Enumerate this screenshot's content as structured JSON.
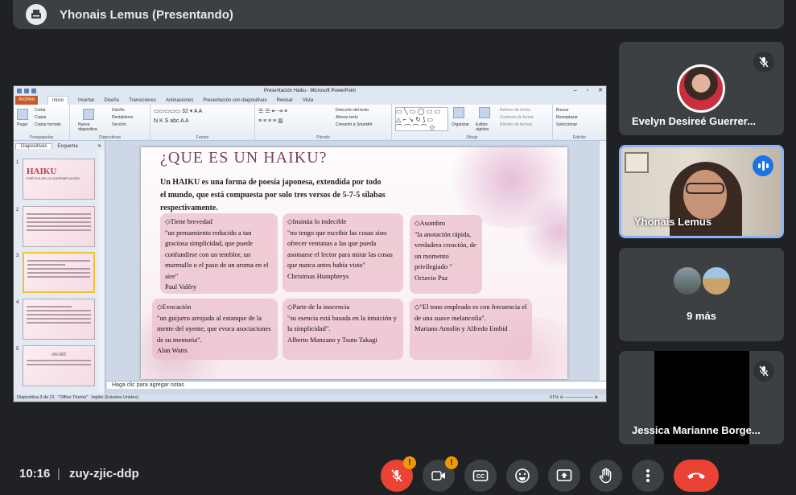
{
  "presenter": {
    "title": "Yhonais Lemus (Presentando)"
  },
  "powerpoint": {
    "window_title": "Presentación Haiku - Microsoft PowerPoint",
    "tabs": [
      "Archivo",
      "Inicio",
      "Insertar",
      "Diseño",
      "Transiciones",
      "Animaciones",
      "Presentación con diapositivas",
      "Revisar",
      "Vista"
    ],
    "ribbon_groups": [
      "Portapapeles",
      "Diapositivas",
      "Fuente",
      "Párrafo",
      "Dibujo",
      "Edición"
    ],
    "ribbon_items": {
      "cortar": "Cortar",
      "copiar": "Copiar",
      "pegar": "Pegar",
      "copiar_formato": "Copiar formato",
      "nueva_diapositiva": "Nueva diapositiva",
      "diseno": "Diseño",
      "restablecer": "Restablecer",
      "seccion": "Sección",
      "direccion_texto": "Dirección del texto",
      "alinear_texto": "Alinear texto",
      "convertir_smartart": "Convertir a SmartArt",
      "organizar": "Organizar",
      "estilos_rapidos": "Estilos rápidos",
      "relleno": "Relleno de forma",
      "contorno": "Contorno de forma",
      "efectos": "Efectos de formas",
      "buscar": "Buscar",
      "reemplazar": "Reemplazar",
      "seleccionar": "Seleccionar"
    },
    "panel_tabs": [
      "Diapositivas",
      "Esquema"
    ],
    "thumbnails": [
      {
        "num": "1",
        "title": "HAIKU",
        "sub": "POÉTICA DE LA CONTEMPLACIÓN"
      },
      {
        "num": "2"
      },
      {
        "num": "3"
      },
      {
        "num": "4"
      },
      {
        "num": "5",
        "title": "AWARE"
      }
    ],
    "slide": {
      "title": "¿QUE ES UN HAIKU?",
      "intro": "Un HAIKU es una forma de poesía japonesa, extendida por todo el mundo, que está compuesta por solo tres versos de 5-7-5 sílabas respectivamente.",
      "cards": [
        {
          "heading": "◇Tiene brevedad",
          "quote": "\"un pensamiento reducido a tan graciosa simplicidad, que puede confundirse con un temblor, un murmullo o el paso de un aroma en el aire\"",
          "author": "Paul Valéry"
        },
        {
          "heading": "◇Insinúa lo indecible",
          "quote": "\"no tengo que escribir las cosas sino ofrecer ventanas a las que pueda asomarse el lector para mirar las cosas que nunca antes había visto\"",
          "author": "Christmas Humphreys"
        },
        {
          "heading": "◇Asombro",
          "quote": "\"la anotación rápida, verdadera creación, de un momento privilegiado \"",
          "author": "Octavio Paz"
        },
        {
          "heading": "◇Evocación",
          "quote": "\"un guijarro arrojado al estanque de la mente del oyente, que evoca asociaciones de su memoria\".",
          "author": "Alan Watts"
        },
        {
          "heading": "◇Parte de la inocencia",
          "quote": "\"su esencia está basada en la intuición y la simplicidad\".",
          "author": "Alberto Manzano y Tsuto Takagi"
        },
        {
          "heading": "◇\"El tono empleado es con frecuencia el de una suave melancolía\".",
          "quote": "",
          "author": "Mariano Antolín y Alfredo Embid"
        }
      ]
    },
    "notes_placeholder": "Haga clic para agregar notas",
    "status": {
      "slide": "Diapositiva 3 de 21",
      "theme": "\"Office Theme\"",
      "language": "Inglés (Estados Unidos)",
      "zoom": "51%"
    }
  },
  "participants": [
    {
      "name": "Evelyn Desireé Guerrer...",
      "muted": true
    },
    {
      "name": "Yhonais Lemus",
      "speaking": true
    },
    {
      "name": "9 más"
    },
    {
      "name": "Jessica Marianne Borge...",
      "muted": true
    }
  ],
  "meeting": {
    "time": "10:16",
    "separator": "|",
    "code": "zuy-zjic-ddp"
  },
  "colors": {
    "background": "#202124",
    "tile": "#3c4043",
    "end_call": "#ea4335",
    "warning": "#f29900",
    "speaking": "#8ab4f8"
  },
  "icons": [
    "typewriter-avatar-icon",
    "mic-off-icon",
    "camera-off-icon",
    "captions-icon",
    "emoji-icon",
    "present-icon",
    "raise-hand-icon",
    "more-options-icon",
    "end-call-icon"
  ],
  "warning_badge": "!"
}
